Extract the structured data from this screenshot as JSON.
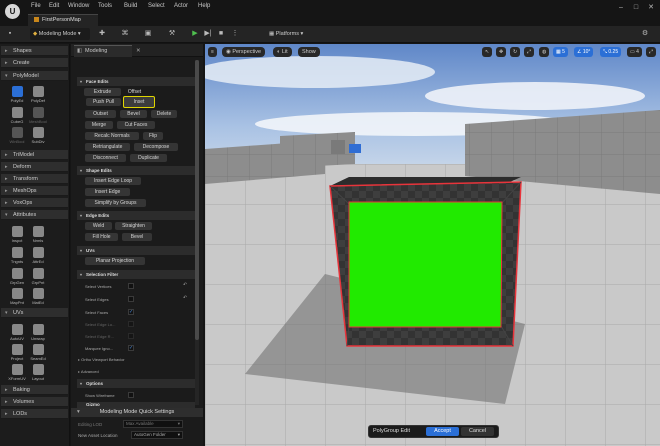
{
  "app": {
    "logo": "U",
    "menu": [
      "File",
      "Edit",
      "Window",
      "Tools",
      "Build",
      "Select",
      "Actor",
      "Help"
    ],
    "tab_title": "FirstPersonMap"
  },
  "toolbar": {
    "mode_label": "Modeling Mode",
    "platforms_label": "Platforms"
  },
  "categories": {
    "shapes": "Shapes",
    "create": "Create",
    "polymodel": "PolyModel",
    "trimodel": "TriModel",
    "deform": "Deform",
    "transform": "Transform",
    "meshops": "MeshOps",
    "voxops": "VoxOps",
    "attributes": "Attributes",
    "uvs": "UVs",
    "baking": "Baking",
    "volumes": "Volumes",
    "lods": "LODs"
  },
  "polymodel_tools": [
    "PolyEd",
    "PolyDef",
    "CubeG",
    "MeshBool",
    "WinBool",
    "SubDiv"
  ],
  "attributes_tools": [
    "Inspct",
    "Nrmls",
    "Tngnts",
    "AttrEd",
    "GrpGen",
    "GrpPnt",
    "MapPnt",
    "MatEd"
  ],
  "uv_tools": [
    "AutoUV",
    "Unwrap",
    "Project",
    "SeamEd",
    "XFormUV",
    "Layout"
  ],
  "panel": {
    "tab": "Modeling",
    "face_edits": {
      "header": "Face Edits",
      "buttons": [
        "Extrude",
        "Offset",
        "Push Pull",
        "Inset",
        "Outset",
        "Bevel",
        "Delete",
        "Merge",
        "Cut Faces",
        "Recalc Normals",
        "Flip",
        "Retriangulate",
        "Decompose",
        "Disconnect",
        "Duplicate"
      ]
    },
    "shape_edits": {
      "header": "Shape Edits",
      "buttons": [
        "Insert Edge Loop",
        "Insert Edge",
        "Simplify by Groups"
      ]
    },
    "edge_edits": {
      "header": "Edge Edits",
      "buttons": [
        "Weld",
        "Straighten",
        "Fill Hole",
        "Bevel"
      ]
    },
    "uvs": {
      "header": "UVs",
      "buttons": [
        "Planar Projection"
      ]
    },
    "selection_filter": {
      "header": "Selection Filter",
      "rows": [
        {
          "label": "Select Vertices",
          "checked": false,
          "enabled": true
        },
        {
          "label": "Select Edges",
          "checked": false,
          "enabled": true
        },
        {
          "label": "Select Faces",
          "checked": true,
          "enabled": true
        },
        {
          "label": "Select Edge Lo...",
          "checked": false,
          "enabled": false
        },
        {
          "label": "Select Edge R...",
          "checked": false,
          "enabled": false
        },
        {
          "label": "Marquee Igno...",
          "checked": true,
          "enabled": true
        }
      ],
      "viewport_behavior": "Ortho Viewport Behavior",
      "advanced": "Advanced"
    },
    "options": {
      "header": "Options",
      "show_wireframe": "Show Wireframe"
    },
    "gizmo": "Gizmo"
  },
  "quick_settings": {
    "title": "Modeling Mode Quick Settings",
    "editing_lod_label": "Editing LOD",
    "editing_lod_value": "Max Available",
    "asset_location_label": "New Asset Location",
    "asset_location_value": "AutoGen Folder"
  },
  "viewport": {
    "perspective": "Perspective",
    "lit": "Lit",
    "show": "Show",
    "grid_value": "5",
    "angle_value": "10°",
    "scale_value": "0.25",
    "camera_speed": "4"
  },
  "accept_bar": {
    "label": "PolyGroup Edit",
    "accept": "Accept",
    "cancel": "Cancel"
  }
}
